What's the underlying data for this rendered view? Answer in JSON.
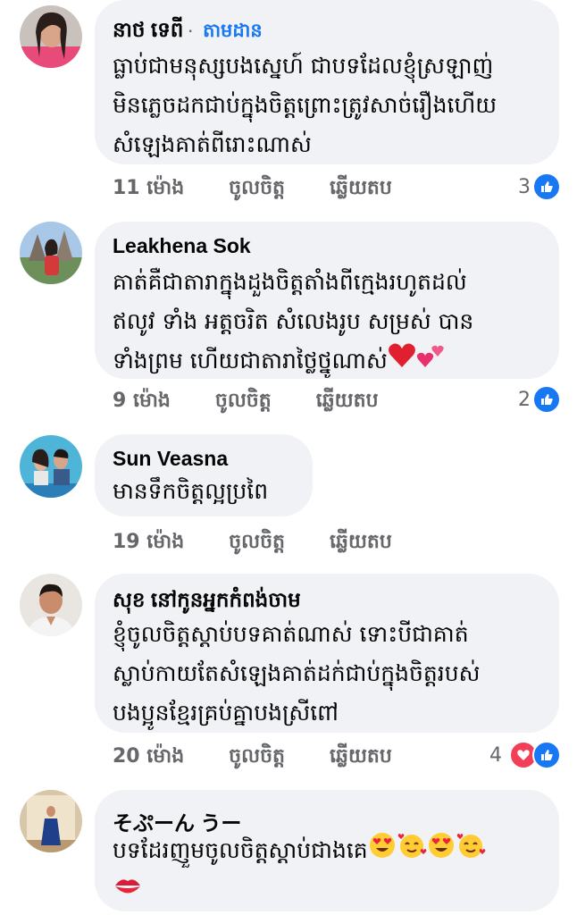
{
  "comments": [
    {
      "name": "នាថ ទេពី",
      "follow_label": "តាមដាន",
      "text": [
        "ធ្លាប់ជាមនុស្សបងស្នេហ៍ ជាបទដែលខ្ញុំស្រឡាញ់",
        "មិនភ្លេចដកជាប់ក្នុងចិត្តព្រោះត្រូវសាច់រឿងហើយ",
        "សំឡេងគាត់ពីរោះណាស់"
      ],
      "time": "11 ម៉ោង",
      "like_label": "ចូលចិត្ត",
      "reply_label": "ឆ្លើយតប",
      "reaction_count": "3"
    },
    {
      "name": "Leakhena Sok",
      "text": [
        "គាត់គឺជាតារាក្នុងដួងចិត្តតាំងពីក្មេងរហូតដល់",
        "ឥលូវ ទាំង អត្តចរិត សំលេងរូប សម្រស់ បាន",
        "ទាំងព្រម ហើយជាតារាថ្លៃថ្នូណាស់"
      ],
      "time": "9 ម៉ោង",
      "like_label": "ចូលចិត្ត",
      "reply_label": "ឆ្លើយតប",
      "reaction_count": "2"
    },
    {
      "name": "Sun Veasna",
      "text": [
        "មានទឹកចិត្តល្អប្រពៃ"
      ],
      "time": "19 ម៉ោង",
      "like_label": "ចូលចិត្ត",
      "reply_label": "ឆ្លើយតប"
    },
    {
      "name": "សុខ នៅកូនអ្នកកំពង់ចាម",
      "text": [
        "ខ្ញុំចូលចិត្តស្ដាប់បទគាត់ណាស់ ទោះបីជាគាត់",
        "ស្លាប់កាយតែសំឡេងគាត់ដក់ជាប់ក្នុងចិត្តរបស់",
        "បងប្អូនខ្មែរគ្រប់គ្នាបងស្រីពៅ"
      ],
      "time": "20 ម៉ោង",
      "like_label": "ចូលចិត្ត",
      "reply_label": "ឆ្លើយតប",
      "reaction_count": "4"
    },
    {
      "name": "そぷーん うー",
      "text": [
        "បទដែរញួមចូលចិត្តស្ដាប់ជាងគេ"
      ]
    }
  ],
  "colors": {
    "bubble": "#f0f2f5",
    "like": "#1877f2",
    "love": "#f33e58",
    "meta": "#65676b"
  },
  "icons": [
    "like-icon",
    "love-icon",
    "heart-eyes-emoji",
    "smiling-hearts-emoji",
    "red-heart-emoji",
    "two-hearts-emoji",
    "kiss-mark-emoji"
  ]
}
